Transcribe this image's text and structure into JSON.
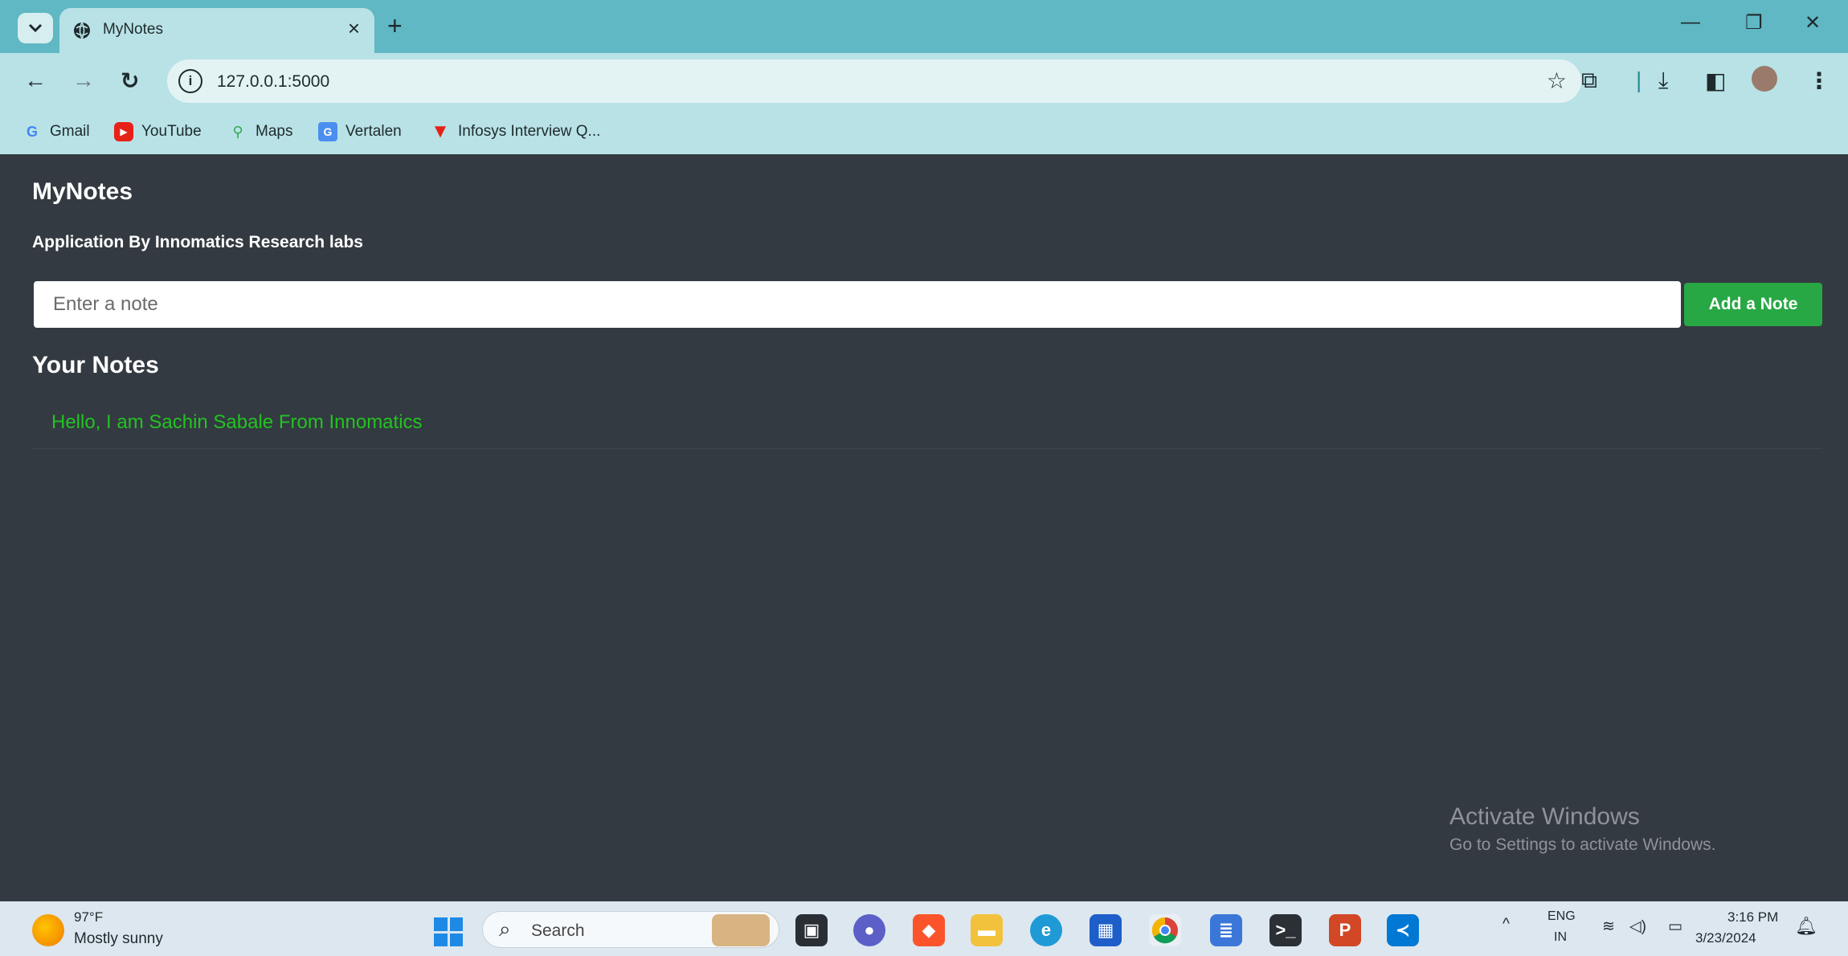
{
  "browser": {
    "tab_title": "MyNotes",
    "url": "127.0.0.1:5000",
    "bookmarks": [
      {
        "label": "Gmail",
        "icon": "gmail-icon"
      },
      {
        "label": "YouTube",
        "icon": "youtube-icon"
      },
      {
        "label": "Maps",
        "icon": "maps-icon"
      },
      {
        "label": "Vertalen",
        "icon": "translate-icon"
      },
      {
        "label": "Infosys Interview Q...",
        "icon": "infosys-icon"
      }
    ]
  },
  "app": {
    "title": "MyNotes",
    "subtitle": "Application By Innomatics Research labs",
    "input_placeholder": "Enter a note",
    "add_button": "Add a Note",
    "notes_heading": "Your Notes",
    "notes": [
      "Hello, I am Sachin Sabale From Innomatics"
    ]
  },
  "watermark": {
    "line1": "Activate Windows",
    "line2": "Go to Settings to activate Windows."
  },
  "taskbar": {
    "weather_temp": "97°F",
    "weather_condition": "Mostly sunny",
    "search_placeholder": "Search",
    "language_top": "ENG",
    "language_bottom": "IN",
    "time": "3:16 PM",
    "date": "3/23/2024"
  },
  "colors": {
    "page_bg": "#343a41",
    "chrome_bg": "#5fb8c3",
    "toolbar_bg": "#b8e2e6",
    "add_button_bg": "#28a745",
    "note_text": "#22c322"
  }
}
